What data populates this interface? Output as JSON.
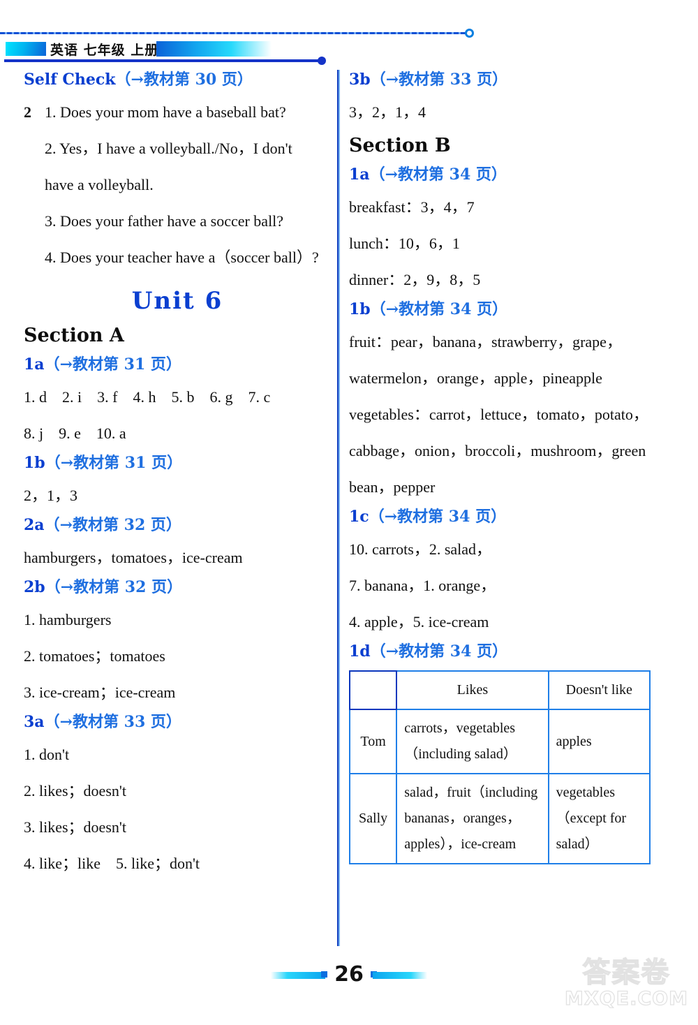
{
  "header": {
    "book_title": "英语 七年级 上册"
  },
  "left_column": {
    "self_check": {
      "label": "Self Check",
      "ref": "（→教材第 30 页）",
      "group_number": "2",
      "items": [
        "1. Does your mom have a baseball bat?",
        "2. Yes，I have a volleyball./No，I don't",
        "have a volleyball.",
        "3. Does your father have a soccer ball?",
        "4. Does your teacher have a（soccer ball）?"
      ]
    },
    "unit_title": "Unit 6",
    "section_a_title": "Section A",
    "exercises": [
      {
        "code": "1a",
        "ref": "（→教材第 31 页）",
        "lines": [
          "1. d　2. i　3. f　4. h　5. b　6. g　7. c",
          "8. j　9. e　10. a"
        ]
      },
      {
        "code": "1b",
        "ref": "（→教材第 31 页）",
        "lines": [
          "2，1，3"
        ]
      },
      {
        "code": "2a",
        "ref": "（→教材第 32 页）",
        "lines": [
          "hamburgers，tomatoes，ice-cream"
        ]
      },
      {
        "code": "2b",
        "ref": "（→教材第 32 页）",
        "lines": [
          "1. hamburgers",
          "2. tomatoes；tomatoes",
          "3. ice-cream；ice-cream"
        ]
      },
      {
        "code": "3a",
        "ref": "（→教材第 33 页）",
        "lines": [
          "1. don't",
          "2. likes；doesn't",
          "3. likes；doesn't",
          "4. like；like　5. like；don't"
        ]
      }
    ]
  },
  "right_column": {
    "exercise_3b": {
      "code": "3b",
      "ref": "（→教材第 33 页）",
      "lines": [
        "3，2，1，4"
      ]
    },
    "section_b_title": "Section B",
    "exercises": [
      {
        "code": "1a",
        "ref": "（→教材第 34 页）",
        "lines": [
          "breakfast：3，4，7",
          "lunch：10，6，1",
          "dinner：2，9，8，5"
        ]
      },
      {
        "code": "1b",
        "ref": "（→教材第 34 页）",
        "lines": [
          "fruit：pear，banana，strawberry，grape，",
          "watermelon，orange，apple，pineapple",
          "vegetables：carrot，lettuce，tomato，potato，",
          "cabbage，onion，broccoli，mushroom，green",
          "bean，pepper"
        ]
      },
      {
        "code": "1c",
        "ref": "（→教材第 34 页）",
        "lines": [
          "10. carrots，2. salad，",
          "7. banana，1. orange，",
          "4. apple，5. ice-cream"
        ]
      },
      {
        "code": "1d",
        "ref": "（→教材第 34 页）",
        "lines": []
      }
    ],
    "table": {
      "columns": [
        "",
        "Likes",
        "Doesn't like"
      ],
      "rows": [
        {
          "name": "Tom",
          "likes": "carrots，vegetables\n（including salad）",
          "dislikes": "apples"
        },
        {
          "name": "Sally",
          "likes": "salad，fruit（including\nbananas，oranges，\napples），ice-cream",
          "dislikes": "vegetables\n（except for\nsalad）"
        }
      ]
    }
  },
  "footer": {
    "page_number": "26"
  },
  "watermark": {
    "chinese": "答案卷",
    "domain": "MXQE.COM"
  }
}
